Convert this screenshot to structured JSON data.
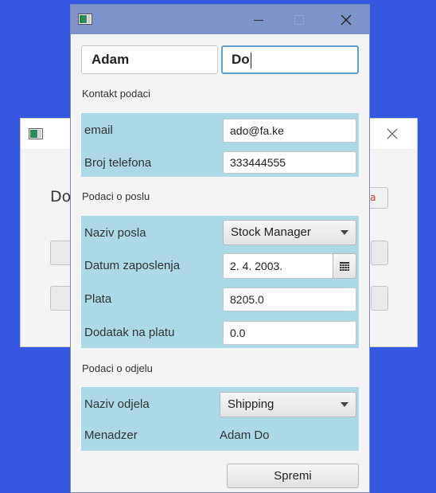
{
  "background_window": {
    "partial_text": "Do",
    "partial_button_text": "va"
  },
  "dialog": {
    "first_name": "Adam",
    "last_name": "Do",
    "contact_section": {
      "title": "Kontakt podaci",
      "email_label": "email",
      "email_value": "ado@fa.ke",
      "phone_label": "Broj telefona",
      "phone_value": "333444555"
    },
    "job_section": {
      "title": "Podaci o poslu",
      "job_title_label": "Naziv posla",
      "job_title_value": "Stock Manager",
      "hire_date_label": "Datum zaposlenja",
      "hire_date_value": "2. 4. 2003.",
      "salary_label": "Plata",
      "salary_value": "8205.0",
      "bonus_label": "Dodatak na platu",
      "bonus_value": "0.0"
    },
    "department_section": {
      "title": "Podaci o odjelu",
      "department_label": "Naziv odjela",
      "department_value": "Shipping",
      "manager_label": "Menadzer",
      "manager_value": "Adam Do"
    },
    "save_label": "Spremi"
  },
  "colors": {
    "desktop": "#3558e0",
    "titlebar": "#7d93c9",
    "panel": "#add8e6",
    "focus": "#5ba1d3"
  }
}
